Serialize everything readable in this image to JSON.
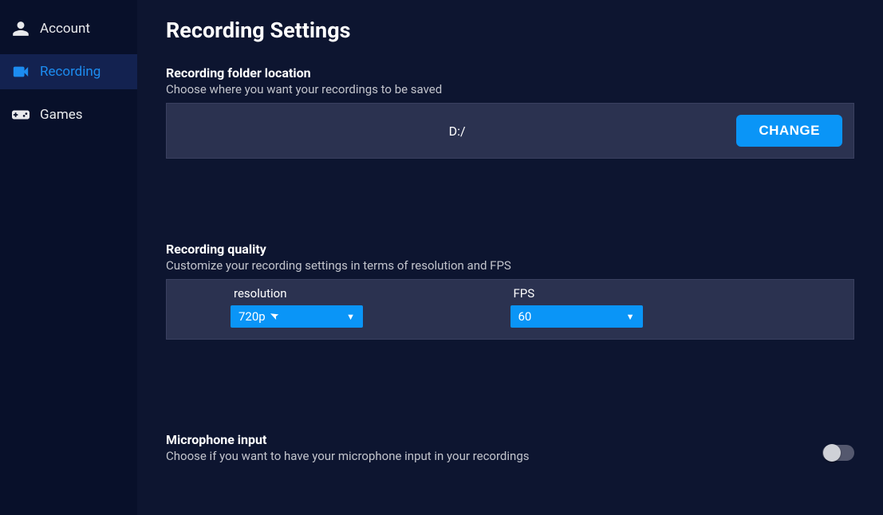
{
  "sidebar": {
    "items": [
      {
        "label": "Account",
        "icon": "person-icon",
        "active": false
      },
      {
        "label": "Recording",
        "icon": "camera-icon",
        "active": true
      },
      {
        "label": "Games",
        "icon": "gamepad-icon",
        "active": false
      }
    ]
  },
  "page": {
    "title": "Recording Settings"
  },
  "folder": {
    "title": "Recording folder location",
    "description": "Choose where you want your recordings to be saved",
    "path": "D:/",
    "change_label": "CHANGE"
  },
  "quality": {
    "title": "Recording quality",
    "description": "Customize your recording settings in terms of resolution and FPS",
    "resolution_label": "resolution",
    "resolution_value": "720p",
    "fps_label": "FPS",
    "fps_value": "60"
  },
  "microphone": {
    "title": "Microphone input",
    "description": "Choose if you want to have your microphone input in your recordings",
    "enabled": false
  }
}
